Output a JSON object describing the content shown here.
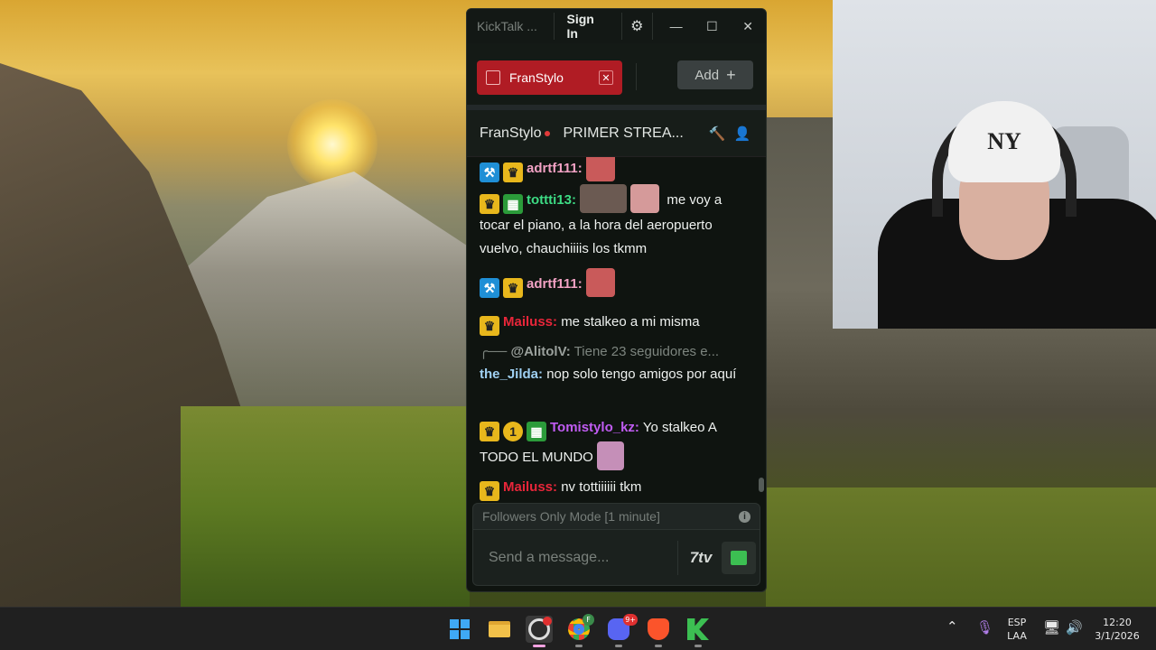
{
  "window": {
    "title": "KickTalk ...",
    "signin_label": "Sign In",
    "tab": {
      "name": "FranStylo"
    },
    "add_label": "Add"
  },
  "channel": {
    "name": "FranStylo",
    "stream_title": "PRIMER STREA..."
  },
  "chat": {
    "messages": [
      {
        "user": "adrtf111:",
        "user_color": "#f2a2c4",
        "text": ""
      },
      {
        "user": "tottti13:",
        "user_color": "#3ddc84",
        "text": "me voy a tocar el piano, a la hora del aeropuerto vuelvo, chauchiiiis los tkmm"
      },
      {
        "user": "adrtf111:",
        "user_color": "#f2a2c4",
        "text": ""
      },
      {
        "user": "Mailuss:",
        "user_color": "#e8263a",
        "text": "me stalkeo a mi misma"
      },
      {
        "user": "the_Jilda:",
        "user_color": "#9fd0f2",
        "text": "nop solo tengo amigos por aquí"
      },
      {
        "user": "Tomistylo_kz:",
        "user_color": "#c05cf2",
        "text": "Yo stalkeo A TODO EL MUNDO"
      },
      {
        "user": "Mailuss:",
        "user_color": "#e8263a",
        "text": "nv tottiiiiii tkm"
      }
    ],
    "reply": {
      "user": "@AlitolV:",
      "text": "Tiene 23 seguidores e..."
    }
  },
  "followers_mode": "Followers Only Mode [1 minute]",
  "input": {
    "placeholder": "Send a message..."
  },
  "seventv_label": "7tv",
  "taskbar": {
    "lang_top": "ESP",
    "lang_bottom": "LAA",
    "time": "12:20",
    "date": "3/1/2026",
    "discord_badge": "9+",
    "chrome_badge": "F"
  },
  "webcam": {
    "beanie_logo": "NY"
  },
  "colors": {
    "accent_tab": "#b01c24",
    "kick_green": "#3cbf52",
    "window_bg": "#0f1410"
  },
  "icons": [
    "gear-icon",
    "minimize-icon",
    "maximize-icon",
    "close-icon",
    "plus-icon",
    "hammer-icon",
    "user-icon",
    "info-icon",
    "seventv-icon",
    "kick-emote-icon"
  ]
}
